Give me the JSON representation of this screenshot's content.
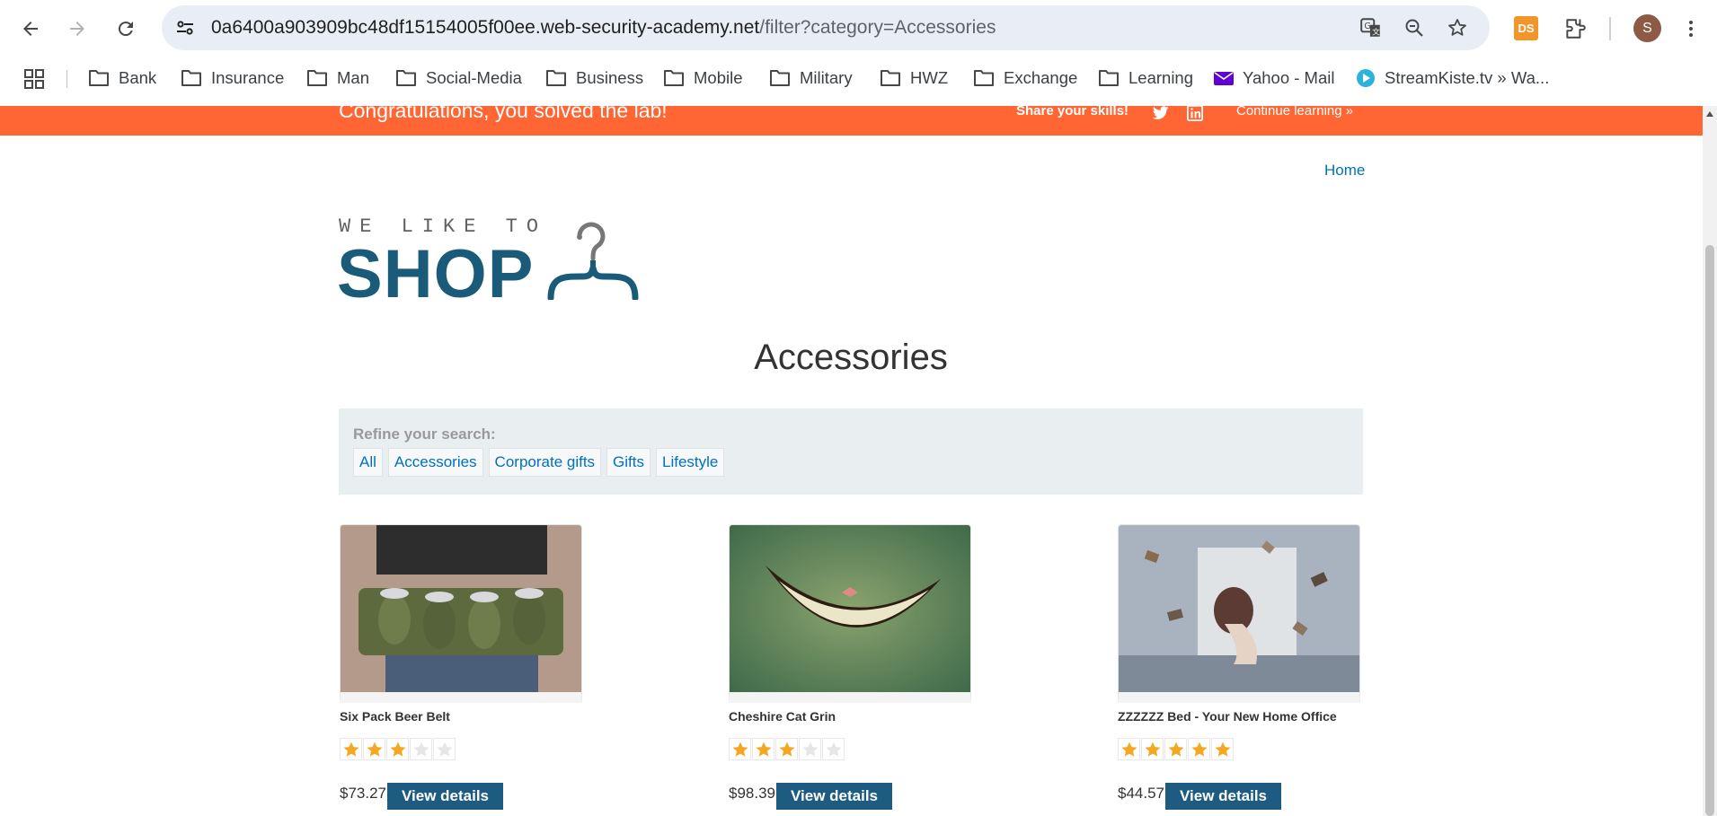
{
  "browser": {
    "url_host": "0a6400a903909bc48df15154005f00ee.web-security-academy.net",
    "url_path": "/filter?category=Accessories",
    "extension_badge": "DS",
    "profile_initial": "S",
    "bookmarks": [
      "Bank",
      "Insurance",
      "Man",
      "Social-Media",
      "Business",
      "Mobile",
      "Military",
      "HWZ",
      "Exchange",
      "Learning",
      "Yahoo - Mail",
      "StreamKiste.tv » Wa..."
    ]
  },
  "banner": {
    "message": "Congratulations, you solved the lab!",
    "share": "Share your skills!",
    "continue": "Continue learning »",
    "color": "#ff6633"
  },
  "nav": {
    "home": "Home"
  },
  "logo": {
    "tagline": "WE LIKE TO",
    "word": "SHOP"
  },
  "page": {
    "title": "Accessories"
  },
  "filters": {
    "label": "Refine your search:",
    "categories": [
      "All",
      "Accessories",
      "Corporate gifts",
      "Gifts",
      "Lifestyle"
    ]
  },
  "products": [
    {
      "name": "Six Pack Beer Belt",
      "rating": 3,
      "price": "$73.27",
      "button": "View details",
      "image": "beer-belt-photo"
    },
    {
      "name": "Cheshire Cat Grin",
      "rating": 3,
      "price": "$98.39",
      "button": "View details",
      "image": "cat-grin-illustration"
    },
    {
      "name": "ZZZZZZ Bed - Your New Home Office",
      "rating": 5,
      "price": "$44.57",
      "button": "View details",
      "image": "bed-office-photo"
    }
  ],
  "colors": {
    "accent": "#1d5c80",
    "link": "#0071bc",
    "star": "#f5a623"
  }
}
